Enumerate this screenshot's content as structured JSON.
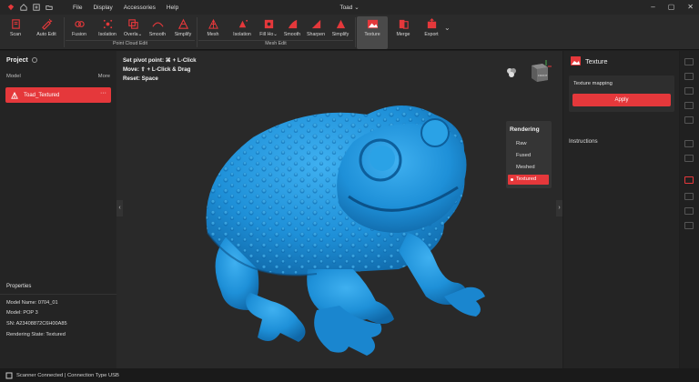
{
  "titlebar": {
    "menu": [
      "File",
      "Display",
      "Accessories",
      "Help"
    ],
    "document_title": "Toad",
    "title_chevron": "chevron-down-icon",
    "window_controls": [
      "minimize-icon",
      "maximize-icon",
      "close-icon"
    ]
  },
  "toolbar": {
    "tools": [
      {
        "label": "Scan",
        "icon": "scan-icon"
      },
      {
        "label": "Auto Edit",
        "icon": "auto-edit-icon"
      },
      {
        "label": "Fusion",
        "icon": "fusion-icon"
      },
      {
        "label": "Isolation",
        "icon": "isolation-icon"
      },
      {
        "label": "Overla⌄",
        "icon": "overlap-icon"
      },
      {
        "label": "Smooth",
        "icon": "smooth-icon"
      },
      {
        "label": "Simplify",
        "icon": "simplify-icon"
      },
      {
        "label": "Mesh",
        "icon": "mesh-icon"
      },
      {
        "label": "Isolation",
        "icon": "isolation-icon"
      },
      {
        "label": "Fill Ho⌄",
        "icon": "fill-holes-icon"
      },
      {
        "label": "Smooth",
        "icon": "smooth-icon"
      },
      {
        "label": "Sharpen",
        "icon": "sharpen-icon"
      },
      {
        "label": "Simplify",
        "icon": "simplify-icon"
      },
      {
        "label": "Texture",
        "icon": "texture-icon"
      },
      {
        "label": "Merge",
        "icon": "merge-icon"
      },
      {
        "label": "Export",
        "icon": "export-icon"
      }
    ],
    "groups": {
      "point_cloud": "Point Cloud Edit",
      "mesh": "Mesh Edit"
    },
    "active_tool": "Texture"
  },
  "left_panel": {
    "title": "Project",
    "col_model": "Model",
    "col_more": "More",
    "model_item": "Toad_Textured",
    "model_menu": "···",
    "properties": {
      "title": "Properties",
      "rows": [
        "Model Name:  0704_01",
        "Model:  POP 3",
        "SN:  A23408872C6H00A85",
        "Rendering State:  Textured"
      ]
    }
  },
  "viewport": {
    "hints": [
      "Set pivot point: ⌘ + L-Click",
      "Move: ⇧ + L-Click & Drag",
      "Reset: Space"
    ],
    "rendering": {
      "title": "Rendering",
      "options": [
        "Raw",
        "Fused",
        "Meshed",
        "Textured"
      ],
      "selected": "Textured"
    },
    "model_color": "#1e90d8",
    "view_cube_label": "FRONT"
  },
  "right_panel": {
    "title": "Texture",
    "section_label": "Texture mapping",
    "apply_label": "Apply",
    "instructions": "Instructions"
  },
  "status": {
    "text": "Scanner Connected | Connection Type USB"
  },
  "colors": {
    "accent": "#e5383b",
    "background": "#1e1e1e",
    "panel": "#242424",
    "viewport": "#292929"
  }
}
